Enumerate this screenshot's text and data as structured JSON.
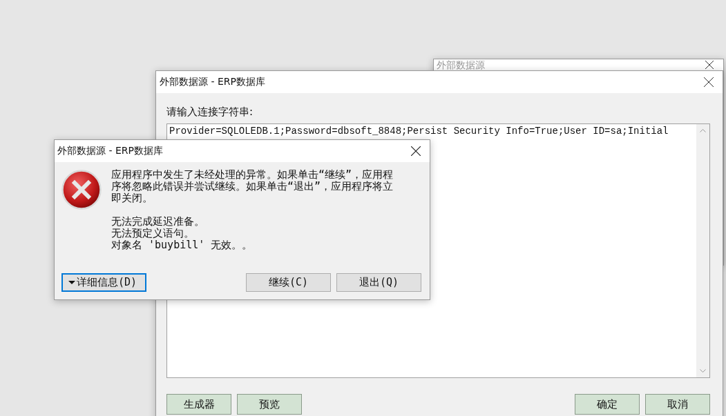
{
  "back_window": {
    "title": "外部数据源"
  },
  "main_window": {
    "title": "外部数据源 - ERP数据库",
    "prompt": "请输入连接字符串:",
    "connection_string": "Provider=SQLOLEDB.1;Password=dbsoft_8848;Persist Security Info=True;User ID=sa;Initial",
    "left_buttons": [
      "生成器",
      "预览"
    ],
    "right_buttons": [
      "确定",
      "取消"
    ]
  },
  "error_dialog": {
    "title": "外部数据源 - ERP数据库",
    "message": "应用程序中发生了未经处理的异常。如果单击“继续”，应用程序将忽略此错误并尝试继续。如果单击“退出”，应用程序将立即关闭。",
    "details": [
      "无法完成延迟准备。",
      "无法预定义语句。",
      "对象名 'buybill' 无效。。"
    ],
    "details_button": {
      "label": "详细信息(D)",
      "focused": true
    },
    "buttons": [
      {
        "label": "继续(C)",
        "focused": false
      },
      {
        "label": "退出(Q)",
        "focused": false
      }
    ]
  }
}
